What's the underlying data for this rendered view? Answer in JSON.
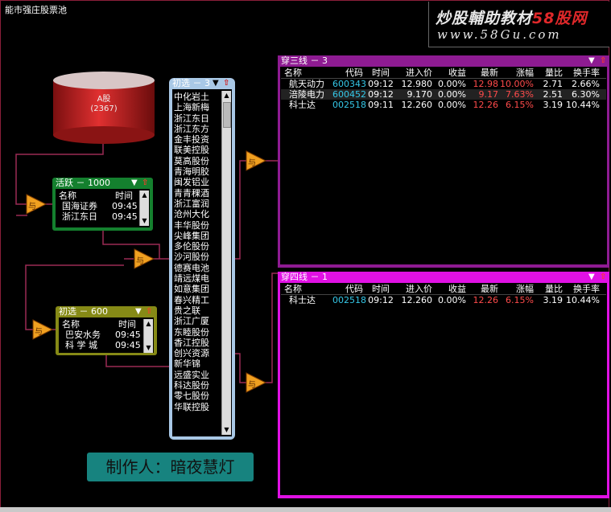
{
  "window": {
    "title": "能市强庄股票池"
  },
  "brand": {
    "line1_a": "炒股輔助教材",
    "line1_b": "58股网",
    "line2": "www.58Gu.com"
  },
  "database": {
    "label": "A股",
    "count": "(2367)"
  },
  "panels": {
    "active": {
      "header": "活跃 － 1000",
      "columns": [
        "名称",
        "时间"
      ],
      "rows": [
        [
          "国海证券",
          "09:45"
        ],
        [
          "浙江东日",
          "09:45"
        ]
      ]
    },
    "initial": {
      "header": "初选 － 600",
      "columns": [
        "名称",
        "时间"
      ],
      "rows": [
        [
          "巴安水务",
          "09:45"
        ],
        [
          "科 学 城",
          "09:45"
        ]
      ]
    },
    "list": {
      "header": "初选 － 3",
      "items": [
        "中化岩土",
        "上海新梅",
        "浙江东日",
        "浙江东方",
        "金丰投资",
        "联美控股",
        "莫高股份",
        "青海明胶",
        "闽发铝业",
        "青青稞酒",
        "浙江富润",
        "沧州大化",
        "丰华股份",
        "尖峰集团",
        "多伦股份",
        "沙河股份",
        "德赛电池",
        "靖远煤电",
        "如意集团",
        "春兴精工",
        "贵之联",
        "浙江广厦",
        "东睦股份",
        "香江控股",
        "创兴资源",
        "新华锦",
        "远盛实业",
        "科达股份",
        "零七股份",
        "华联控股"
      ]
    },
    "three": {
      "header": "穿三线 － 3",
      "columns": [
        "名称",
        "代码",
        "时间",
        "进入价",
        "收益",
        "最新",
        "涨幅",
        "量比",
        "换手率"
      ],
      "rows": [
        [
          "航天动力",
          "600343",
          "09:12",
          "12.980",
          "0.00%",
          "12.98",
          "10.00%",
          "2.71",
          "2.66%"
        ],
        [
          "涪陵电力",
          "600452",
          "09:12",
          "9.170",
          "0.00%",
          "9.17",
          "7.63%",
          "2.51",
          "6.30%"
        ],
        [
          "科士达",
          "002518",
          "09:11",
          "12.260",
          "0.00%",
          "12.26",
          "6.15%",
          "3.19",
          "10.44%"
        ]
      ]
    },
    "four": {
      "header": "穿四线 － 1",
      "columns": [
        "名称",
        "代码",
        "时间",
        "进入价",
        "收益",
        "最新",
        "涨幅",
        "量比",
        "换手率"
      ],
      "rows": [
        [
          "科士达",
          "002518",
          "09:12",
          "12.260",
          "0.00%",
          "12.26",
          "6.15%",
          "3.19",
          "10.44%"
        ]
      ]
    }
  },
  "filters": {
    "symbol": "与"
  },
  "credit": {
    "text": "制作人：暗夜慧灯"
  },
  "colors": {
    "green_panel": "#14802e",
    "olive_panel": "#868a16",
    "purple_panel": "#8e1b92",
    "magenta_panel": "#e011e4",
    "list_panel": "#a9c8e6",
    "wire": "#9b2b54",
    "code_cyan": "#35c8e8",
    "up_red": "#ff4b4b",
    "filter_fill": "#f0a020"
  },
  "icons": {
    "dropdown": "dropdown-icon",
    "close": "close-arrow-icon",
    "scroll_up": "scroll-up-icon",
    "scroll_down": "scroll-down-icon",
    "filter": "filter-triangle-icon"
  }
}
